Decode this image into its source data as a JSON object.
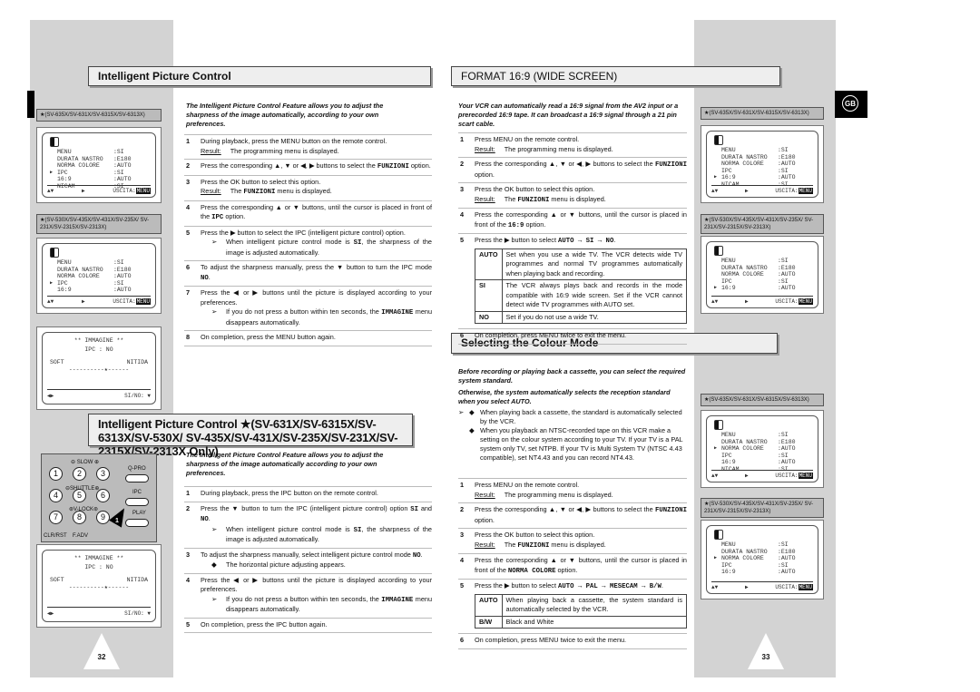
{
  "left_page": {
    "page_number": "32",
    "ipc_title": "Intelligent Picture Control",
    "ipc_intro": "The Intelligent Picture Control Feature allows you to adjust the sharpness of the image automatically, according to your own preferences.",
    "ipc_steps": [
      {
        "n": "1",
        "text": [
          "During playback, press the MENU button on the remote control."
        ],
        "result": [
          "The programming menu is displayed."
        ]
      },
      {
        "n": "2",
        "text": [
          "Press the corresponding ▲, ▼ or ◀, ▶ buttons to select the ",
          {
            "c": "FUNZIONI"
          },
          " option."
        ]
      },
      {
        "n": "3",
        "text": [
          "Press the OK button to select this option."
        ],
        "result": [
          "The ",
          {
            "c": "FUNZIONI"
          },
          " menu is displayed."
        ]
      },
      {
        "n": "4",
        "text": [
          "Press the corresponding ▲ or ▼ buttons, until the cursor is placed in front of the ",
          {
            "c": "IPC"
          },
          " option."
        ]
      },
      {
        "n": "5",
        "text": [
          "Press the ▶ button to select the IPC (intelligent picture control) option."
        ],
        "note": [
          "When intelligent picture control mode is ",
          {
            "c": "SI"
          },
          ", the sharpness of the image is adjusted automatically."
        ]
      },
      {
        "n": "6",
        "text": [
          "To adjust the sharpness manually, press the ▼ button to turn the IPC mode ",
          {
            "c": "NO"
          },
          "."
        ]
      },
      {
        "n": "7",
        "text": [
          "Press the ◀ or ▶ buttons until the picture is displayed according to your preferences."
        ],
        "note": [
          "If you do not press a button within ten seconds, the ",
          {
            "c": "IMMAGINE"
          },
          " menu disappears automatically."
        ]
      },
      {
        "n": "8",
        "text": [
          "On completion, press the MENU button again."
        ]
      }
    ],
    "ipc2_title": "Intelligent Picture Control ★(SV-631X/SV-6315X/SV-6313X/SV-530X/ SV-435X/SV-431X/SV-235X/SV-231X/SV-2315X/SV-2313X Only)",
    "ipc2_intro": "The Intelligent Picture Control Feature allows you to adjust the sharpness of the image automatically according to your own preferences.",
    "ipc2_steps": [
      {
        "n": "1",
        "text": [
          "During playback, press the IPC button on the remote control."
        ]
      },
      {
        "n": "2",
        "text": [
          "Press the ▼ button to turn the IPC (intelligent picture control) option ",
          {
            "c": "SI"
          },
          " and ",
          {
            "c": "NO"
          },
          "."
        ],
        "note": [
          "When intelligent picture control mode is ",
          {
            "c": "SI"
          },
          ", the sharpness of the image is adjusted automatically."
        ]
      },
      {
        "n": "3",
        "text": [
          "To adjust the sharpness manually, select intelligent picture control mode ",
          {
            "c": "NO"
          },
          "."
        ],
        "bullet": [
          "The horizontal picture adjusting appears."
        ]
      },
      {
        "n": "4",
        "text": [
          "Press the ◀ or ▶ buttons until the picture is displayed according to your preferences."
        ],
        "note": [
          "If you do not press a button within ten seconds, the ",
          {
            "c": "IMMAGINE"
          },
          " menu disappears automatically."
        ]
      },
      {
        "n": "5",
        "text": [
          "On completion, press the IPC button again."
        ]
      }
    ],
    "remote": {
      "slow": "⊖ SLOW ⊕",
      "shuttle": "⊖SHUTTLE⊕",
      "vlock": "⊛V-LOCK⊛",
      "qpro": "Q-PRO",
      "ipc": "IPC",
      "play": "PLAY",
      "clr": "CLR/RST",
      "fadv": "F.ADV",
      "callout": "1",
      "digits": [
        "1",
        "2",
        "3",
        "4",
        "5",
        "6",
        "7",
        "8",
        "9"
      ]
    }
  },
  "right_page": {
    "page_number": "33",
    "language_badge": "GB",
    "format_title": "FORMAT 16:9 (WIDE SCREEN)",
    "format_intro": "Your VCR can automatically read a 16:9 signal from the AV2 input or a prerecorded 16:9 tape. It can broadcast a 16:9 signal through a 21 pin scart cable.",
    "format_steps": [
      {
        "n": "1",
        "text": [
          "Press MENU on the remote control."
        ],
        "result": [
          "The programming menu is displayed."
        ]
      },
      {
        "n": "2",
        "text": [
          "Press the corresponding ▲, ▼ or ◀, ▶ buttons to select the ",
          {
            "c": "FUNZIONI"
          },
          " option."
        ]
      },
      {
        "n": "3",
        "text": [
          "Press the OK button to select this option."
        ],
        "result": [
          "The ",
          {
            "c": "FUNZIONI"
          },
          " menu is displayed."
        ]
      },
      {
        "n": "4",
        "text": [
          "Press the corresponding ▲ or ▼ buttons, until the cursor is placed in front of the ",
          {
            "c": "16:9"
          },
          " option."
        ]
      },
      {
        "n": "5",
        "text": [
          "Press the ▶ button to select ",
          {
            "c": "AUTO → SI → NO"
          },
          "."
        ],
        "table": [
          [
            "AUTO",
            "Set when you use a wide TV. The VCR detects wide TV programmes and normal TV programmes automatically when playing back and recording."
          ],
          [
            "SI",
            "The VCR always plays back and records in the mode compatible with 16:9 wide screen. Set if the VCR cannot detect wide TV programmes with  AUTO  set."
          ],
          [
            "NO",
            "Set if you do not use a wide TV."
          ]
        ]
      },
      {
        "n": "6",
        "text": [
          "On completion, press MENU twice to exit the menu."
        ]
      }
    ],
    "colour_title": "Selecting the Colour Mode",
    "colour_intro1": "Before recording or playing back a cassette, you can select the required system standard.",
    "colour_intro2": "Otherwise, the system automatically selects the reception standard when you select AUTO.",
    "colour_notes": [
      "When playing back a cassette, the standard is automatically selected by the VCR.",
      "When you playback an NTSC-recorded tape on this VCR make a setting on the colour system according to your TV. If your TV is a PAL system only TV, set NTPB. If your TV is Multi System TV (NTSC 4.43 compatible), set NT4.43 and you can record NT4.43."
    ],
    "colour_steps": [
      {
        "n": "1",
        "text": [
          "Press MENU on the remote control."
        ],
        "result": [
          "The programming menu is displayed."
        ]
      },
      {
        "n": "2",
        "text": [
          "Press the corresponding ▲, ▼ or ◀, ▶ buttons to select the ",
          {
            "c": "FUNZIONI"
          },
          " option."
        ]
      },
      {
        "n": "3",
        "text": [
          "Press the OK button to select this option."
        ],
        "result": [
          "The ",
          {
            "c": "FUNZIONI"
          },
          " menu is displayed."
        ]
      },
      {
        "n": "4",
        "text": [
          "Press the corresponding ▲ or ▼ buttons, until the cursor is placed in front of the ",
          {
            "c": "NORMA COLORE"
          },
          " option."
        ]
      },
      {
        "n": "5",
        "text": [
          "Press the ▶ button to select ",
          {
            "c": "AUTO → PAL → MESECAM → B/W"
          },
          "."
        ],
        "table": [
          [
            "AUTO",
            "When playing back a cassette, the system standard is automatically selected by the VCR."
          ],
          [
            "B/W",
            "Black and White"
          ]
        ]
      },
      {
        "n": "6",
        "text": [
          "On completion, press MENU twice to exit the menu."
        ]
      }
    ]
  },
  "common": {
    "result_label": "Result:",
    "note_arrow": "➢",
    "bullet": "◆",
    "option_icon_label": "OPTIONS"
  },
  "model_labels": {
    "a": "★(SV-635X/SV-631X/SV-6315X/SV-6313X)",
    "b": "★(SV-530X/SV-435X/SV-431X/SV-235X/ SV-231X/SV-2315X/SV-2313X)"
  },
  "menus": {
    "full": [
      [
        "MENU",
        ":SI"
      ],
      [
        "DURATA NASTRO",
        ":E180"
      ],
      [
        "NORMA COLORE",
        ":AUTO"
      ],
      [
        "IPC",
        ":SI"
      ],
      [
        "16:9",
        ":AUTO"
      ],
      [
        "NICAM",
        ":SI"
      ]
    ],
    "short": [
      [
        "MENU",
        ":SI"
      ],
      [
        "DURATA NASTRO",
        ":E180"
      ],
      [
        "NORMA COLORE",
        ":AUTO"
      ],
      [
        "IPC",
        ":SI"
      ],
      [
        "16:9",
        ":AUTO"
      ]
    ],
    "footer": {
      "nav": "▲▼",
      "select": "▶",
      "exit": "USCITA:",
      "key": "MENU"
    },
    "imm": {
      "title": "** IMMAGINE **",
      "ipc": "IPC  :  NO",
      "soft": "SOFT",
      "nitida": "NITIDA",
      "scale": "----------★------",
      "nav": "◀▶",
      "sino": "SI/NO: ▼"
    }
  },
  "colors": {
    "sidebar": "#d3d3d3",
    "header_bg": "#eeeeee",
    "rule": "#bbbbbb"
  }
}
